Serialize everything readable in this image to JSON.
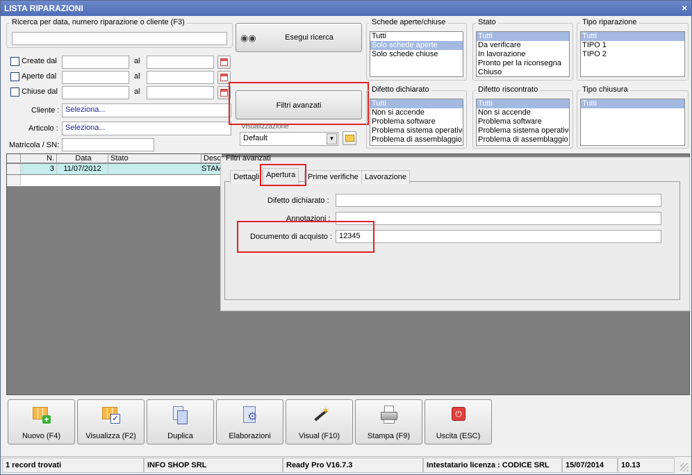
{
  "window": {
    "title": "LISTA RIPARAZIONI",
    "close": "×"
  },
  "search": {
    "group_label": "Ricerca per data, numero riparazione o cliente (F3)",
    "value": "",
    "execute_label": "Esegui ricerca",
    "advanced_label": "Filtri avanzati"
  },
  "dates": {
    "created_label": "Create dal",
    "opened_label": "Aperte dal",
    "closed_label": "Chiuse dal",
    "to_label": "al",
    "rows": [
      {
        "from": "",
        "to": ""
      },
      {
        "from": "",
        "to": ""
      },
      {
        "from": "",
        "to": ""
      }
    ]
  },
  "fields": {
    "cliente_label": "Cliente :",
    "cliente_value": "Seleziona...",
    "articolo_label": "Articolo :",
    "articolo_value": "Seleziona...",
    "matricola_label": "Matricola / SN:",
    "matricola_value": ""
  },
  "view": {
    "label": "Visualizzazione",
    "value": "Default"
  },
  "filters": {
    "schede": {
      "label": "Schede aperte/chiuse",
      "items": [
        "Tutti",
        "Solo schede aperte",
        "Solo schede chiuse"
      ],
      "selected": 1
    },
    "stato": {
      "label": "Stato",
      "items": [
        "Tutti",
        "Da verificare",
        "In lavorazione",
        "Pronto per la riconsegna",
        "Chiuso"
      ],
      "selected": 0
    },
    "tipo_riparazione": {
      "label": "Tipo riparazione",
      "items": [
        "Tutti",
        "TIPO 1",
        "TIPO 2"
      ],
      "selected": 0
    },
    "difetto_dichiarato": {
      "label": "Difetto dichiarato",
      "items": [
        "Tutti",
        "Non si accende",
        "Problema software",
        "Problema sistema operativo",
        "Problema di assemblaggio"
      ],
      "selected": 0
    },
    "difetto_riscontrato": {
      "label": "Difetto riscontrato",
      "items": [
        "Tutti",
        "Non si accende",
        "Problema software",
        "Problema sistema operativo",
        "Problema di assemblaggio"
      ],
      "selected": 0
    },
    "tipo_chiusura": {
      "label": "Tipo chiusura",
      "items": [
        "Tutti"
      ],
      "selected": 0
    }
  },
  "grid": {
    "headers": [
      "N.",
      "Data",
      "Stato",
      "Descr"
    ],
    "rows": [
      {
        "n": "3",
        "data": "11/07/2012",
        "stato": "",
        "descr": "STAM"
      }
    ]
  },
  "advanced": {
    "title": "Filtri avanzati",
    "tabs": [
      "Dettagli",
      "Apertura",
      "Prime verifiche",
      "Lavorazione"
    ],
    "active_tab": 1,
    "difetto_label": "Difetto dichiarato :",
    "difetto_value": "",
    "annotazioni_label": "Annotazioni :",
    "annotazioni_value": "",
    "documento_label": "Documento di acquisto :",
    "documento_value": "12345"
  },
  "toolbar": {
    "buttons": [
      {
        "label": "Nuovo (F4)",
        "icon": "new-grid-icon"
      },
      {
        "label": "Visualizza (F2)",
        "icon": "view-grid-icon"
      },
      {
        "label": "Duplica",
        "icon": "duplicate-icon"
      },
      {
        "label": "Elaborazioni",
        "icon": "process-gear-icon"
      },
      {
        "label": "Visual (F10)",
        "icon": "magic-wand-icon"
      },
      {
        "label": "Stampa (F9)",
        "icon": "printer-icon"
      },
      {
        "label": "Uscita (ESC)",
        "icon": "power-icon"
      }
    ]
  },
  "status": {
    "records": "1 record trovati",
    "company": "INFO SHOP SRL",
    "version": "Ready Pro V16.7.3",
    "license": "Intestatario licenza : CODICE SRL",
    "date": "15/07/2014",
    "time": "10.13"
  },
  "colors": {
    "title_bar": "#5b78c0",
    "selection": "#a4b9e2",
    "grid_row": "#c6ecec",
    "highlight": "#e02020",
    "grid_bg": "#7f7f7f"
  }
}
